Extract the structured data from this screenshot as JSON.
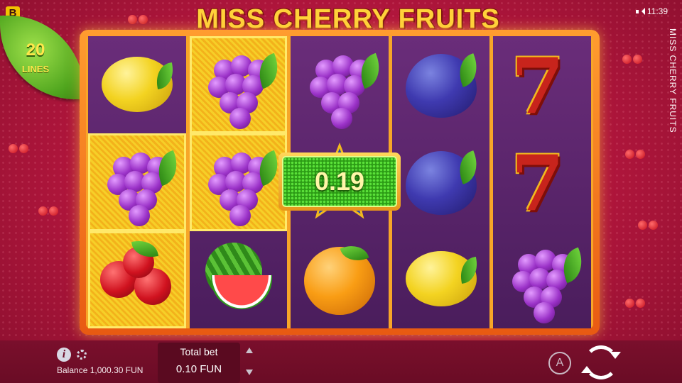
{
  "brand": {
    "badge": "B"
  },
  "status": {
    "time": "11:39",
    "sound_icon": "speaker-icon"
  },
  "game": {
    "title": "MISS CHERRY FRUITS",
    "title_vertical": "MISS CHERRY FRUITS"
  },
  "lines": {
    "count": "20",
    "label": "LINES"
  },
  "win": {
    "amount": "0.19"
  },
  "reels": [
    [
      "lemon",
      "grapes",
      "cherries"
    ],
    [
      "grapes",
      "grapes",
      "watermelon"
    ],
    [
      "grapes",
      "star",
      "orange"
    ],
    [
      "plum",
      "plum",
      "lemon"
    ],
    [
      "seven",
      "seven",
      "grapes"
    ]
  ],
  "winning_cells": [
    [
      0,
      1
    ],
    [
      1,
      0
    ],
    [
      1,
      1
    ],
    [
      2,
      0
    ]
  ],
  "footer": {
    "balance_label": "Balance 1,000.30 FUN",
    "total_bet_label": "Total bet",
    "total_bet_value": "0.10 FUN",
    "autoplay_label": "A"
  },
  "colors": {
    "accent": "#f7a628",
    "win_green": "#2d9d16",
    "background": "#b8173f"
  }
}
